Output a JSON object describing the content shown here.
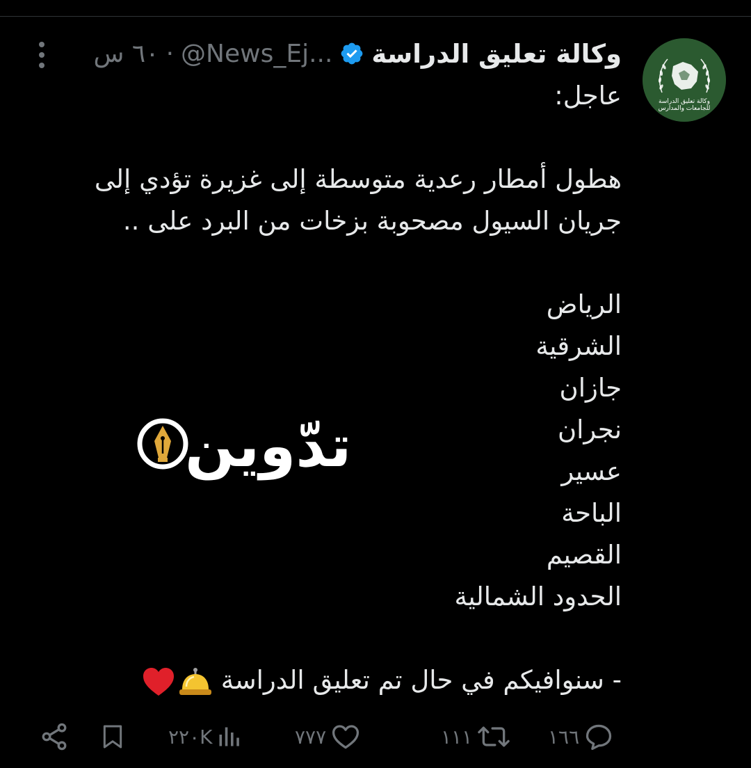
{
  "tweet": {
    "author": {
      "display_name": "وكالة تعليق الدراسة",
      "handle": "@News_Ej...",
      "avatar_caption_line1": "وكالة تعليق الدراسة",
      "avatar_caption_line2": "للجامعات والمدارس",
      "verified_icon": "verified-badge-icon",
      "verified_color": "#1d9bf0"
    },
    "separator": "·",
    "time": "٦٠ س",
    "lines": [
      "عاجل:",
      "",
      "هطول أمطار رعدية متوسطة إلى غزيرة تؤدي إلى",
      "جريان السيول مصحوبة بزخات من البرد على ..",
      "",
      "الرياض",
      "الشرقية",
      "جازان",
      "نجران",
      "عسير",
      "الباحة",
      "القصيم",
      "الحدود الشمالية",
      ""
    ],
    "final_line": "- سنوافيكم في حال تم تعليق الدراسة",
    "final_emojis": [
      "bell-emoji",
      "heart-emoji"
    ],
    "watermark_text": "تدّوين"
  },
  "actions": {
    "replies": "١٦٦",
    "retweets": "١١١",
    "likes": "٧٧٧",
    "views": "٢٢٠K"
  },
  "colors": {
    "background": "#000000",
    "text": "#e7e9ea",
    "muted": "#71767b",
    "avatar_green": "#2b5a30",
    "pen_gold": "#e0a83a"
  }
}
